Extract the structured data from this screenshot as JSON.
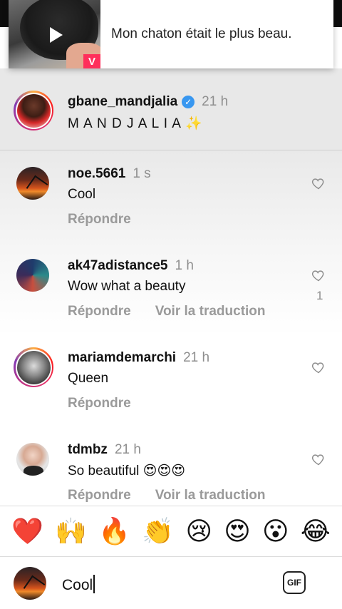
{
  "notification": {
    "text": "Mon chaton était le plus beau.",
    "badge": "V"
  },
  "caption": {
    "username": "gbane_mandjalia",
    "verified": true,
    "time": "21 h",
    "text": "M A N D J A L I A ✨"
  },
  "comments": [
    {
      "username": "noe.5661",
      "time": "1 s",
      "text": "Cool",
      "reply_label": "Répondre",
      "translate_label": "",
      "likes": ""
    },
    {
      "username": "ak47adistance5",
      "time": "1 h",
      "text": "Wow what a beauty",
      "reply_label": "Répondre",
      "translate_label": "Voir la traduction",
      "likes": "1"
    },
    {
      "username": "mariamdemarchi",
      "time": "21 h",
      "text": "Queen",
      "reply_label": "Répondre",
      "translate_label": "",
      "likes": ""
    },
    {
      "username": "tdmbz",
      "time": "21 h",
      "text": "So beautiful 😍😍😍",
      "reply_label": "Répondre",
      "translate_label": "Voir la traduction",
      "likes": ""
    }
  ],
  "emoji_bar": [
    "❤️",
    "🙌",
    "🔥",
    "👏",
    "😢",
    "😍",
    "😮",
    "😂"
  ],
  "input": {
    "value": "Cool",
    "gif_label": "GIF"
  },
  "colors": {
    "verified": "#3897f0",
    "secondary_text": "#8e8e8e",
    "story_ring": "#e1306c"
  }
}
